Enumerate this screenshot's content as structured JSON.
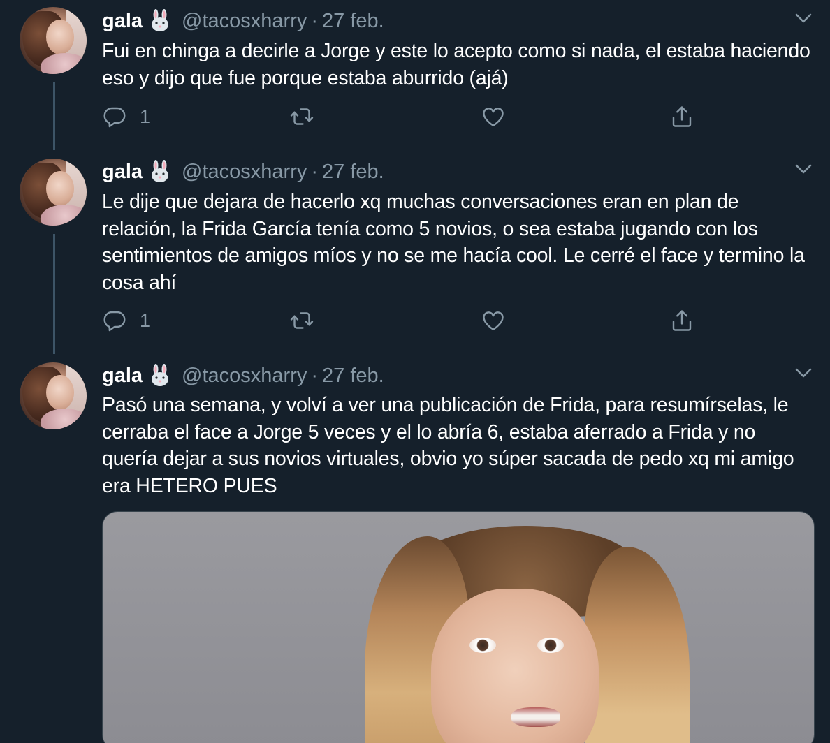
{
  "tweets": [
    {
      "name": "gala",
      "handle": "@tacosxharry",
      "separator": "·",
      "date": "27 feb.",
      "text": "Fui en chinga a decirle a Jorge y este lo acepto como si nada, el estaba haciendo eso y dijo que fue porque estaba aburrido (ajá)",
      "reply_count": "1",
      "retweet_count": "",
      "like_count": ""
    },
    {
      "name": "gala",
      "handle": "@tacosxharry",
      "separator": "·",
      "date": "27 feb.",
      "text": "Le dije que dejara de hacerlo xq muchas conversaciones eran en plan de relación, la Frida García tenía como 5 novios, o sea estaba jugando con los sentimientos de amigos míos y no se me hacía cool. Le cerré el face y termino la cosa ahí",
      "reply_count": "1",
      "retweet_count": "",
      "like_count": ""
    },
    {
      "name": "gala",
      "handle": "@tacosxharry",
      "separator": "·",
      "date": "27 feb.",
      "text": "Pasó una semana, y volví a ver una publicación de Frida, para resumírselas, le cerraba el face a Jorge 5 veces y el lo abría 6, estaba aferrado a Frida y no quería dejar a sus novios virtuales, obvio yo súper sacada de pedo xq mi amigo era HETERO PUES"
    }
  ],
  "icons": {
    "name_emoji": "rabbit-face-icon",
    "menu": "chevron-down-icon",
    "reply": "reply-icon",
    "retweet": "retweet-icon",
    "like": "heart-icon",
    "share": "share-icon"
  },
  "colors": {
    "background": "#15202b",
    "secondary_text": "#8899a6",
    "thread_line": "#3d5466"
  }
}
